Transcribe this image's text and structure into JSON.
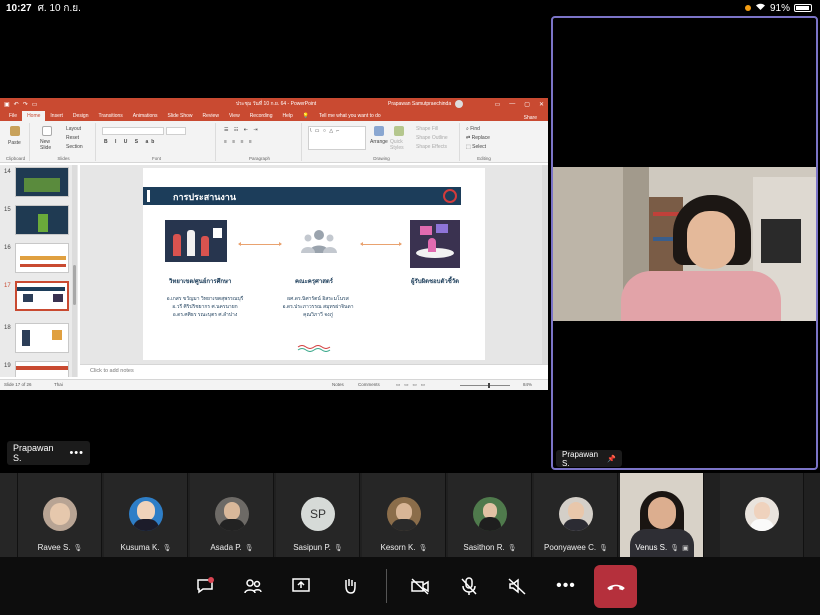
{
  "status_bar": {
    "time": "10:27",
    "date": "ศ. 10 ก.ย.",
    "battery": "91%"
  },
  "ppt": {
    "doc_title": "ประชุม วันที่ 10 ก.ย. 64 - PowerPoint",
    "user": "Prapawan Samutpraechinda",
    "tabs": [
      "File",
      "Home",
      "Insert",
      "Design",
      "Transitions",
      "Animations",
      "Slide Show",
      "Review",
      "View",
      "Recording",
      "Help"
    ],
    "tell_me": "Tell me what you want to do",
    "share": "Share",
    "ribbon": {
      "paste": "Paste",
      "layout": "Layout",
      "reset": "Reset",
      "new_slide": "New Slide",
      "section": "Section",
      "arrange": "Arrange",
      "quick_styles": "Quick Styles",
      "shape_fill": "Shape Fill",
      "shape_outline": "Shape Outline",
      "shape_effects": "Shape Effects",
      "find": "Find",
      "replace": "Replace",
      "select": "Select",
      "groups": [
        "Clipboard",
        "Slides",
        "Font",
        "Paragraph",
        "Drawing",
        "Editing"
      ]
    },
    "thumb_numbers": [
      "14",
      "15",
      "16",
      "17",
      "18",
      "19"
    ],
    "slide": {
      "title": "การประสานงาน",
      "col1_head": "วิทยาเขต/ศูนย์การศึกษา",
      "col1_lines": [
        "อ.เกสร ขวัญมา วิทยาเขตสุพรรณบุรี",
        "อ.วรี ศิริปริชยากร ศ.นครนายก",
        "อ.ดร.ศศิธร รณะบุตร ศ.ลำปาง"
      ],
      "col2_head": "คณะครุศาสตร์",
      "col2_lines": [
        "ผศ.ดร.นิศารัตน์ อิสระมโนรส",
        "อ.ดร.ประภาวรรณ สมุทรผ่าจินดา",
        "คุณวิภาวี จงภู่"
      ],
      "col3_head": "ผู้รับผิดชอบตัวชี้วัด"
    },
    "notes_placeholder": "Click to add notes",
    "status_left": "Slide 17 of 26",
    "status_lang": "Thai",
    "status_notes": "Notes",
    "status_comments": "Comments",
    "zoom": "84%"
  },
  "presenter_tag": "Prapawan S.",
  "speaker_tag": "Prapawan S.",
  "participants": [
    {
      "name": "Ravee S."
    },
    {
      "name": "Kusuma K."
    },
    {
      "name": "Asada P."
    },
    {
      "name": "Sasipun P.",
      "initials": "SP"
    },
    {
      "name": "Kesorn K."
    },
    {
      "name": "Sasithon R."
    },
    {
      "name": "Poonyawee C."
    },
    {
      "name": "Venus S."
    }
  ],
  "colors": {
    "ppt_accent": "#c94a31",
    "speaker_border": "#7b74c7",
    "hangup": "#b5303c",
    "slide_navy": "#1c3d5a"
  }
}
